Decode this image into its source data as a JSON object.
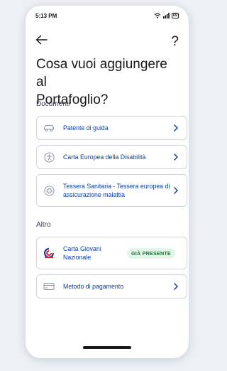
{
  "status": {
    "time": "5:13 PM",
    "battery": "69"
  },
  "nav": {
    "help_label": "?"
  },
  "page": {
    "title_line1": "Cosa vuoi aggiungere al",
    "title_line2": "Portafoglio?"
  },
  "sections": {
    "documents": {
      "label": "Documenti",
      "items": [
        {
          "label": "Patente di guida",
          "icon": "car-icon"
        },
        {
          "label": "Carta Europea della Disabilità",
          "icon": "accessibility-icon"
        },
        {
          "label": "Tessera Sanitaria - Tessera europea di assicurazione malattia",
          "icon": "health-card-icon"
        }
      ]
    },
    "other": {
      "label": "Altro",
      "items": [
        {
          "label": "Carta Giovani Nazionale",
          "icon": "carta-giovani-logo",
          "badge": "GIÀ PRESENTE"
        },
        {
          "label": "Metodo di pagamento",
          "icon": "credit-card-icon"
        }
      ]
    }
  },
  "colors": {
    "accent": "#0b3ea8",
    "badge_bg": "#e3f5e8",
    "badge_text": "#2a6b3e",
    "border": "#cfd4dd"
  }
}
